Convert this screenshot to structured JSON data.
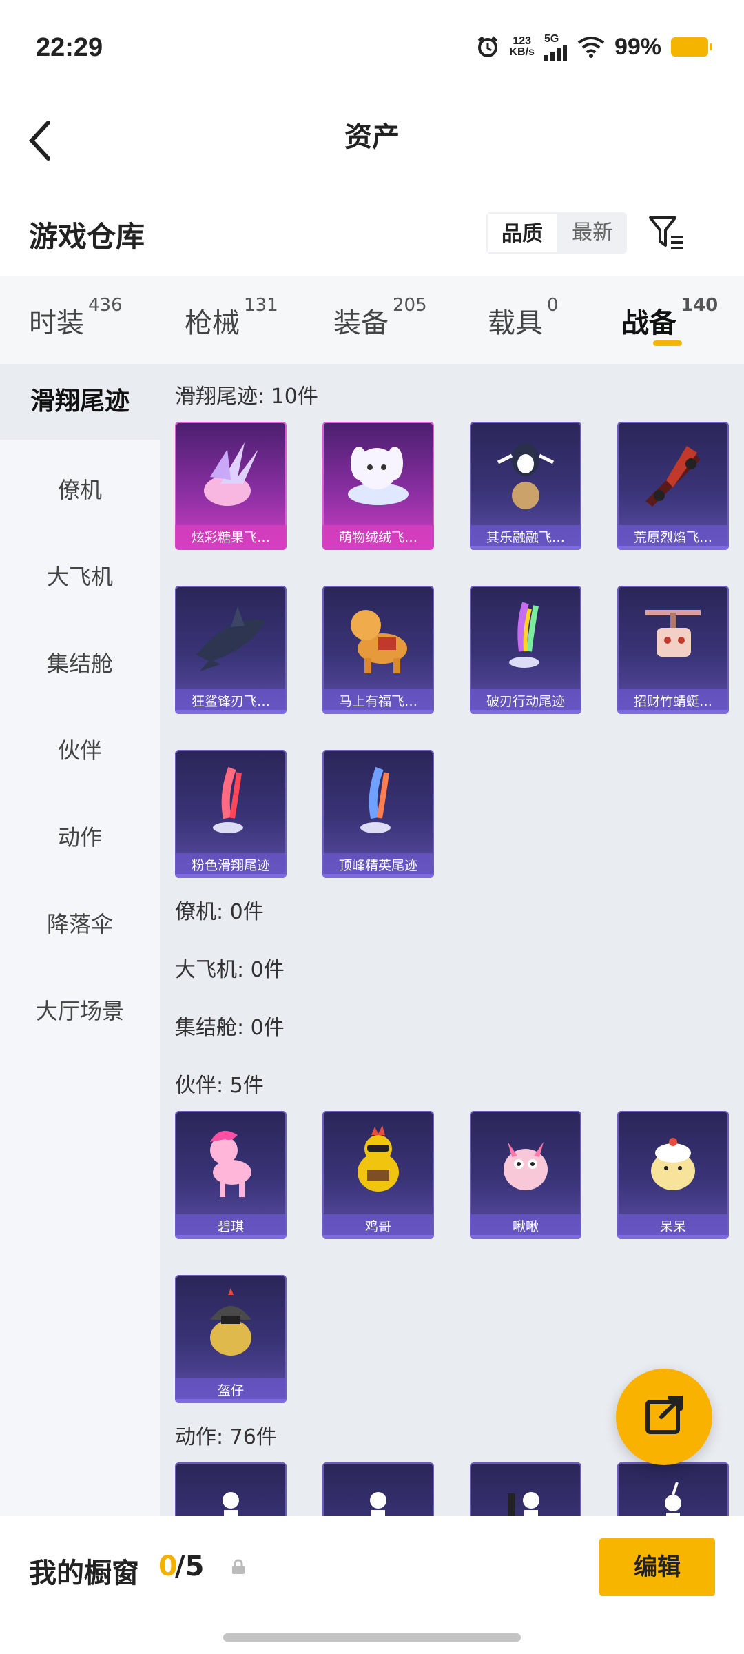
{
  "status_bar": {
    "time": "22:29",
    "net_speed_value": "123",
    "net_speed_unit": "KB/s",
    "network": "5G",
    "battery_pct": "99%"
  },
  "header": {
    "title": "资产"
  },
  "warehouse": {
    "title": "游戏仓库",
    "sort_quality": "品质",
    "sort_newest": "最新"
  },
  "tabs": [
    {
      "label": "时装",
      "count": "436"
    },
    {
      "label": "枪械",
      "count": "131"
    },
    {
      "label": "装备",
      "count": "205"
    },
    {
      "label": "载具",
      "count": "0"
    },
    {
      "label": "战备",
      "count": "140"
    }
  ],
  "sidebar": [
    "滑翔尾迹",
    "僚机",
    "大飞机",
    "集结舱",
    "伙伴",
    "动作",
    "降落伞",
    "大厅场景"
  ],
  "sections": {
    "glide": {
      "title": "滑翔尾迹: 10件",
      "items": [
        "炫彩糖果飞…",
        "萌物绒绒飞…",
        "其乐融融飞…",
        "荒原烈焰飞…",
        "狂鲨锋刃飞…",
        "马上有福飞…",
        "破刃行动尾迹",
        "招财竹蜻蜓…",
        "粉色滑翔尾迹",
        "顶峰精英尾迹"
      ]
    },
    "wingman": {
      "title": "僚机: 0件"
    },
    "plane": {
      "title": "大飞机: 0件"
    },
    "pod": {
      "title": "集结舱: 0件"
    },
    "partner": {
      "title": "伙伴: 5件",
      "items": [
        "碧琪",
        "鸡哥",
        "啾啾",
        "呆呆",
        "盔仔"
      ]
    },
    "emote": {
      "title": "动作: 76件"
    }
  },
  "bottom": {
    "title": "我的橱窗",
    "count_current": "0",
    "count_total": "/5",
    "edit_label": "编辑"
  },
  "colors": {
    "accent": "#f6b600",
    "card_purple": "#3a3478",
    "card_pink": "#d13fc4"
  }
}
